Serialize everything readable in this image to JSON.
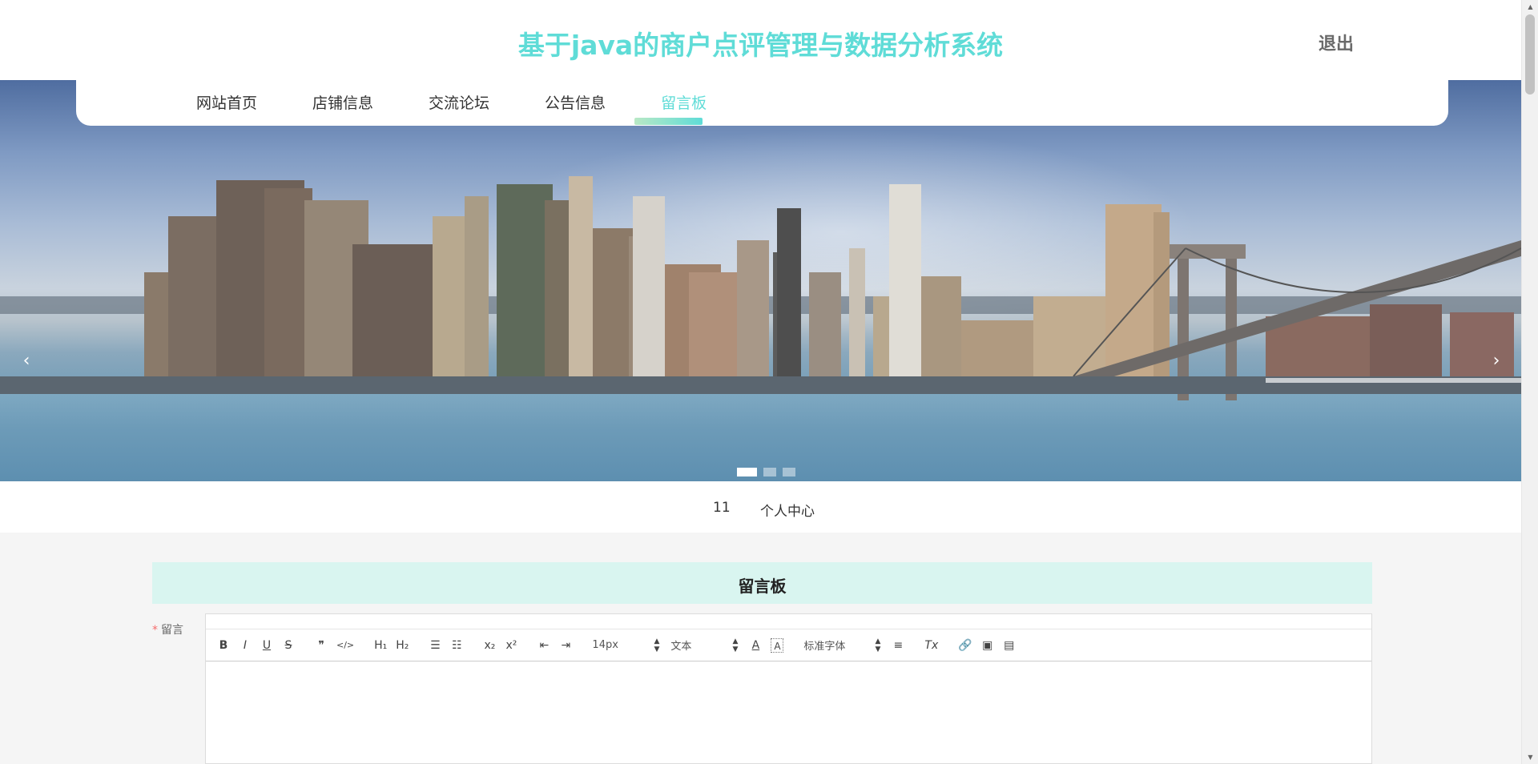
{
  "header": {
    "site_title": "基于java的商户点评管理与数据分析系统",
    "logout_label": "退出"
  },
  "nav": {
    "items": [
      "网站首页",
      "店铺信息",
      "交流论坛",
      "公告信息",
      "留言板"
    ],
    "active_index": 4
  },
  "banner": {
    "prev_glyph": "‹",
    "next_glyph": "›",
    "slide_count": 3,
    "active_slide": 0
  },
  "user": {
    "username": "11",
    "center_label": "个人中心"
  },
  "board": {
    "title": "留言板",
    "field_required_mark": "*",
    "field_label": "留言"
  },
  "toolbar": {
    "bold": "B",
    "italic": "I",
    "underline": "U",
    "strike": "S",
    "blockquote": "❞",
    "code": "</>",
    "h1": "H₁",
    "h2": "H₂",
    "ordered_list": "☰",
    "bullet_list": "☷",
    "subscript": "x₂",
    "superscript": "x²",
    "outdent": "⇤",
    "indent": "⇥",
    "font_size": "14px",
    "header_select": "文本",
    "font_family": "标准字体",
    "align": "≡",
    "clean": "Tx",
    "link": "🔗",
    "image": "▣",
    "video": "▤"
  },
  "colors": {
    "accent": "#5fdcd7",
    "board_bg": "#d9f5f0",
    "required": "#f56c6c"
  }
}
